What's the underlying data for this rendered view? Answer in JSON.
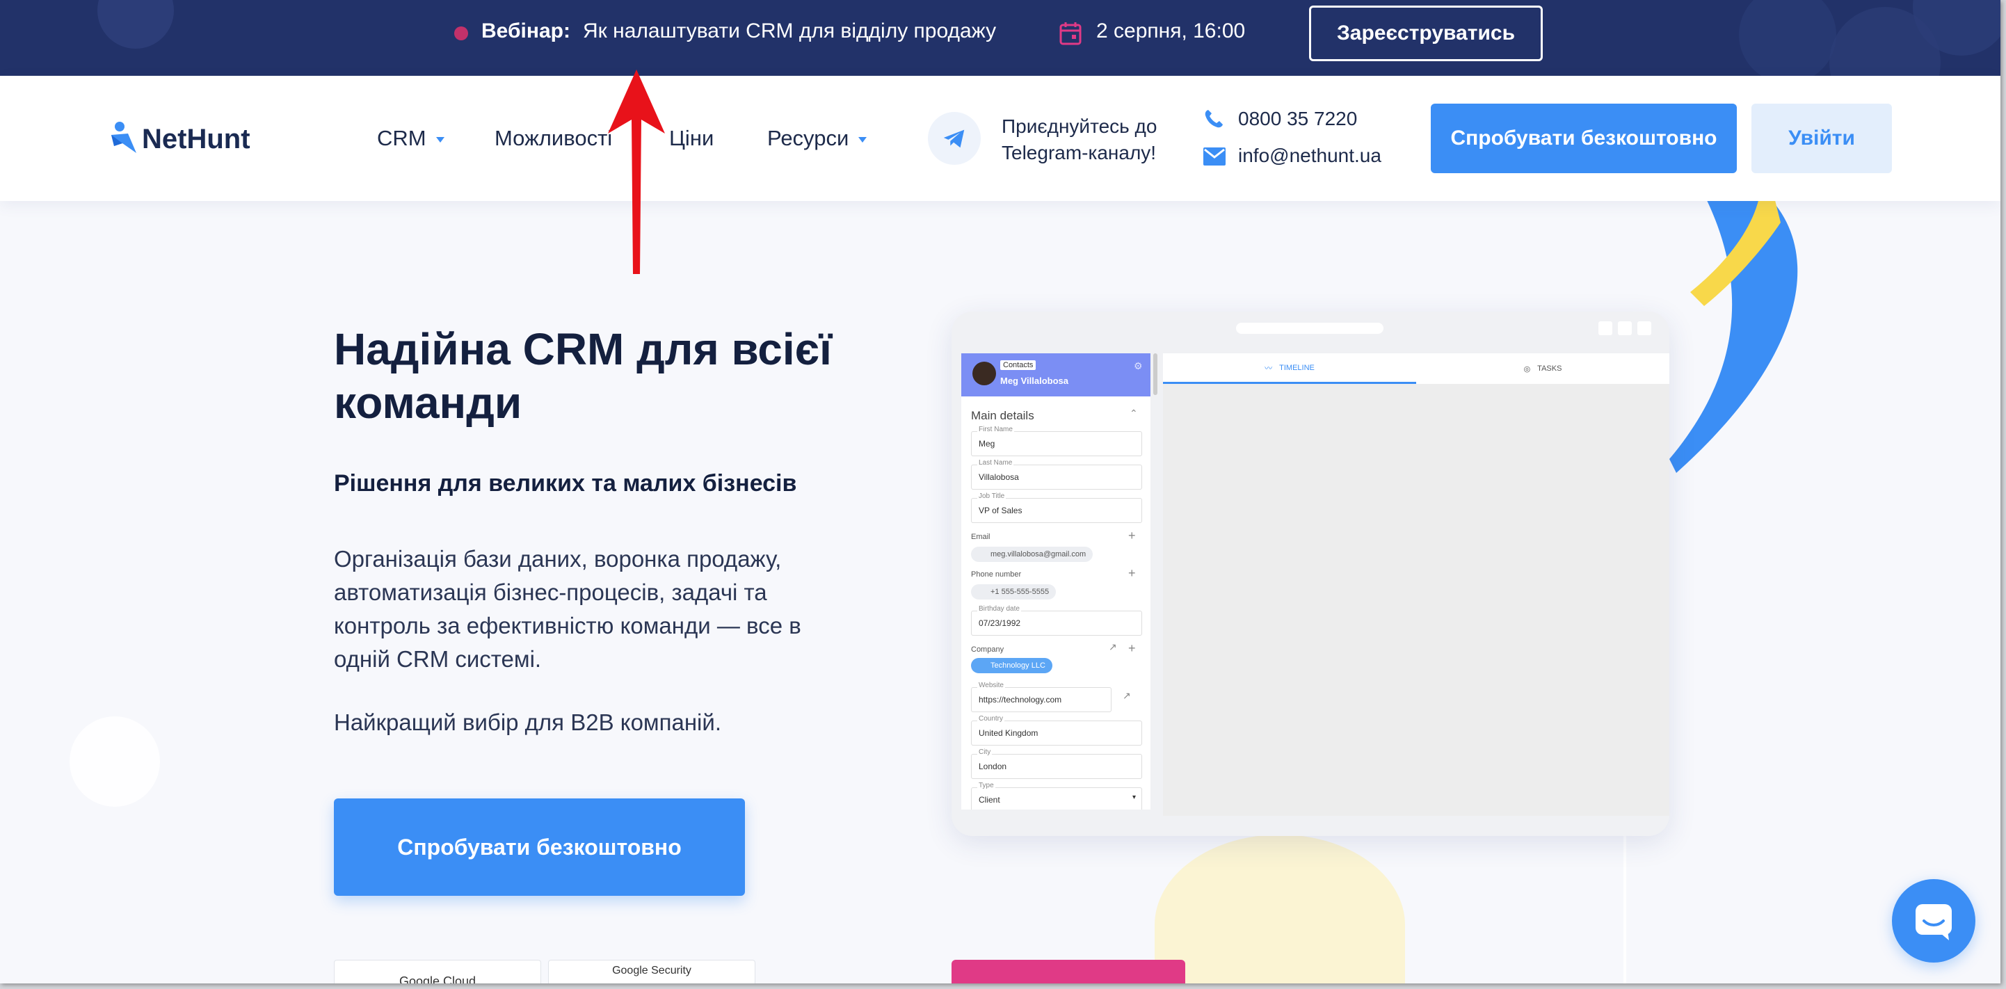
{
  "banner": {
    "label": "Вебінар:",
    "text": "Як налаштувати CRM для відділу продажу",
    "date": "2 серпня, 16:00",
    "register_label": "Зареєструватись",
    "icons": [
      "dot-icon",
      "calendar-icon"
    ]
  },
  "header": {
    "logo_text": "NetHunt",
    "nav": [
      {
        "label": "CRM",
        "has_dropdown": true
      },
      {
        "label": "Можливості",
        "has_dropdown": false
      },
      {
        "label": "Ціни",
        "has_dropdown": false
      },
      {
        "label": "Ресурси",
        "has_dropdown": true
      }
    ],
    "telegram_line1": "Приєднуйтесь до",
    "telegram_line2": "Telegram-каналу!",
    "phone": "0800 35 7220",
    "email": "info@nethunt.ua",
    "try_label": "Спробувати безкоштовно",
    "login_label": "Увійти"
  },
  "hero": {
    "title": "Надійна CRM для всієї команди",
    "subtitle": "Рішення для великих та малих бізнесів",
    "text": "Організація бази даних, воронка продажу, автоматизація бізнес-процесів, задачі та контроль за ефективністю команди — все в одній CRM системі.",
    "b2b": "Найкращий вибір для B2B компаній.",
    "cta_label": "Спробувати безкоштовно"
  },
  "badges": [
    "Google Cloud",
    "Google Security"
  ],
  "mockup": {
    "tag": "Contacts",
    "name": "Meg Villalobosa",
    "section": "Main details",
    "fields": {
      "first_name_label": "First Name",
      "first_name": "Meg",
      "last_name_label": "Last Name",
      "last_name": "Villalobosa",
      "job_title_label": "Job Title",
      "job_title": "VP of Sales",
      "email_label": "Email",
      "email": "meg.villalobosa@gmail.com",
      "phone_label": "Phone number",
      "phone": "+1 555-555-5555",
      "birthday_label": "Birthday date",
      "birthday": "07/23/1992",
      "company_label": "Company",
      "company": "Technology LLC",
      "website_label": "Website",
      "website": "https://technology.com",
      "country_label": "Country",
      "country": "United Kingdom",
      "city_label": "City",
      "city": "London",
      "type_label": "Type",
      "type": "Client"
    },
    "tab_timeline": "TIMELINE",
    "tab_tasks": "TASKS"
  },
  "colors": {
    "banner_bg": "#223269",
    "primary": "#3b8ef5",
    "login_bg": "#e3eefc",
    "title": "#14203f",
    "accent_pink": "#e03a86",
    "accent_yellow": "#f8d84a",
    "arrow": "#e8121a"
  }
}
